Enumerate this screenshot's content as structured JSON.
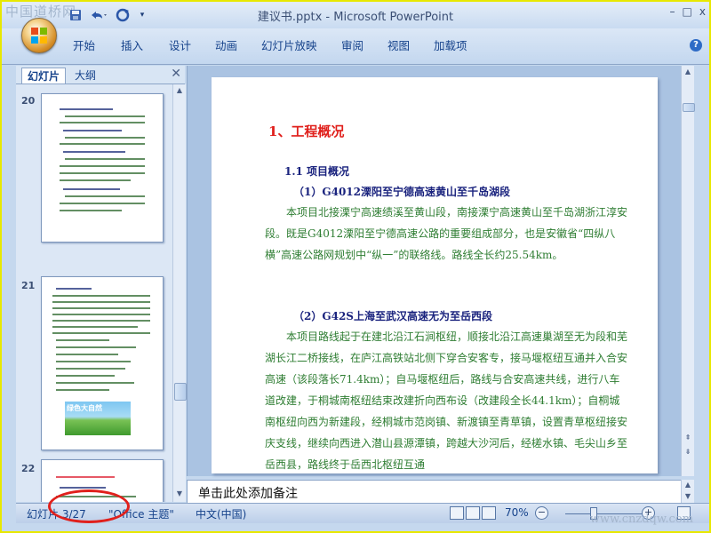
{
  "watermark_top": "中国道桥网",
  "watermark_bottom": "www.cnzdqw.com",
  "title_bar": {
    "title": "建议书.pptx - Microsoft PowerPoint"
  },
  "quick_access": {
    "dropdown": "▾"
  },
  "window_controls": {
    "minimize": "–",
    "maximize": "□",
    "close": "x"
  },
  "ribbon_tabs": [
    "开始",
    "插入",
    "设计",
    "动画",
    "幻灯片放映",
    "审阅",
    "视图",
    "加载项"
  ],
  "help": "?",
  "slide_panel": {
    "tab_slides": "幻灯片",
    "tab_outline": "大纲",
    "close": "✕"
  },
  "thumbnails": [
    {
      "number": "20"
    },
    {
      "number": "21",
      "image_caption": "绿色大自然"
    },
    {
      "number": "22"
    }
  ],
  "slide": {
    "heading": "1、工程概况",
    "subheading": "1.1 项目概况",
    "section1_title": "（1）G4012溧阳至宁德高速黄山至千岛湖段",
    "section1_text": "本项目北接溧宁高速绩溪至黄山段，南接溧宁高速黄山至千岛湖浙江淳安段。既是G4012溧阳至宁德高速公路的重要组成部分，也是安徽省“四纵八横”高速公路网规划中“纵一”的联络线。路线全长约25.54km。",
    "section2_title": "（2）G42S上海至武汉高速无为至岳西段",
    "section2_text": "本项目路线起于在建北沿江石涧枢纽，顺接北沿江高速巢湖至无为段和芜湖长江二桥接线，在庐江高铁站北侧下穿合安客专，接马堰枢纽互通并入合安高速（该段落长71.4km）；自马堰枢纽后，路线与合安高速共线，进行八车道改建，于桐城南枢纽结束改建折向西布设（改建段全长44.1km）；自桐城南枢纽向西为新建段，经桐城市范岗镇、新渡镇至青草镇，设置青草枢纽接安庆支线，继续向西进入潜山县源潭镇，跨越大沙河后，经槎水镇、毛尖山乡至岳西县，路线终于岳西北枢纽互通"
  },
  "notes_placeholder": "单击此处添加备注",
  "status_bar": {
    "slide_counter": "幻灯片 3/27",
    "theme": "\"Office 主题\"",
    "language": "中文(中国)",
    "zoom": "70%",
    "zoom_minus": "−",
    "zoom_plus": "+"
  },
  "colors": {
    "heading": "#e0201c",
    "subheading": "#1a237e",
    "body_text": "#2e7d32",
    "highlight_circle": "#e0201c"
  }
}
